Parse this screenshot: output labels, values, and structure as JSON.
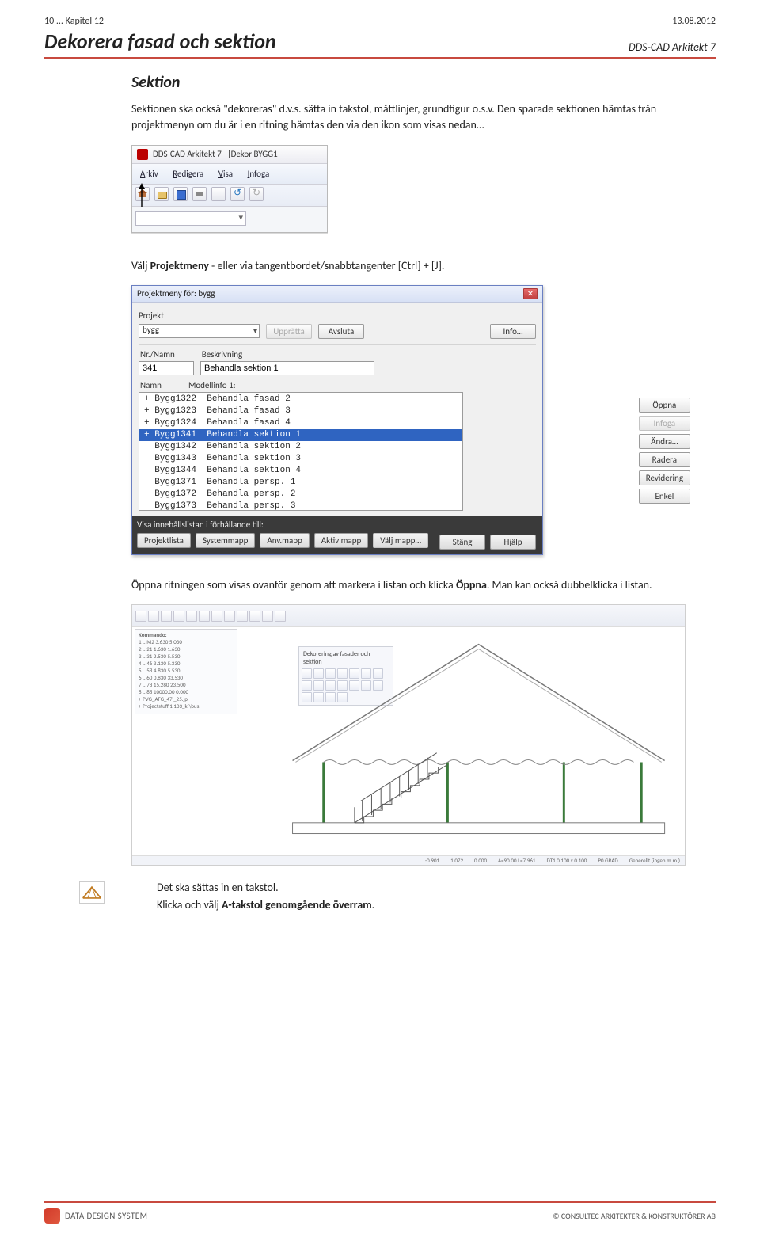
{
  "header": {
    "chapter_ref": "10 ... Kapitel 12",
    "date": "13.08.2012",
    "title_left": "Dekorera fasad och sektion",
    "title_right": "DDS-CAD Arkitekt 7"
  },
  "section": {
    "heading": "Sektion",
    "p1": "Sektionen ska också \"dekoreras\" d.v.s. sätta in takstol, måttlinjer, grundfigur o.s.v. Den sparade sektionen hämtas från projektmenyn om du är i en ritning hämtas den via den ikon som visas nedan…"
  },
  "toolbox": {
    "win_title": "DDS-CAD Arkitekt 7 - [Dekor   BYGG1",
    "menu": {
      "m1": "Arkiv",
      "m2": "Redigera",
      "m3": "Visa",
      "m4": "Infoga"
    }
  },
  "mid_text": "Välj Projektmeny - eller via tangentbordet/snabbtangenter [Ctrl] + [J].",
  "dlg": {
    "title": "Projektmeny för: bygg",
    "projekt_label": "Projekt",
    "projekt_value": "bygg",
    "btn_uppratta": "Upprätta",
    "btn_avsluta": "Avsluta",
    "btn_info": "Info…",
    "col_nr": "Nr./Namn",
    "col_beskr": "Beskrivning",
    "num_field": "341",
    "desc_field": "Behandla sektion 1",
    "col_namn": "Namn",
    "col_model": "Modellinfo 1:",
    "rows": [
      "+ Bygg1322  Behandla fasad 2",
      "+ Bygg1323  Behandla fasad 3",
      "+ Bygg1324  Behandla fasad 4",
      "+ Bygg1341  Behandla sektion 1",
      "  Bygg1342  Behandla sektion 2",
      "  Bygg1343  Behandla sektion 3",
      "  Bygg1344  Behandla sektion 4",
      "  Bygg1371  Behandla persp. 1",
      "  Bygg1372  Behandla persp. 2",
      "  Bygg1373  Behandla persp. 3"
    ],
    "side": {
      "oppna": "Öppna",
      "infoga": "Infoga",
      "andra": "Ändra…",
      "radera": "Radera",
      "revidering": "Revidering",
      "enkel": "Enkel"
    },
    "bottom_label": "Visa innehållslistan i förhållande till:",
    "bottom_btns": {
      "projektlista": "Projektlista",
      "systemmapp": "Systemmapp",
      "anvmapp": "Anv.mapp",
      "aktivmapp": "Aktiv mapp",
      "valjmapp": "Välj mapp…",
      "stang": "Stäng",
      "hjalp": "Hjälp"
    }
  },
  "after_dlg": {
    "part1": "Öppna ritningen som visas ovanför genom att markera i listan och klicka ",
    "bold": "Öppna",
    "part2": ". Man kan också dubbelklicka i listan."
  },
  "cad": {
    "palette_title": "Dekorering av fasader och sektion",
    "panel_title": "Kommando:",
    "panel_lines": [
      " 1 .. M2   3.630   5.030",
      " 2 .. 21   1.630   1.630",
      " 3 .. 31   2.530   5.530",
      " 4 .. 46   3.130   5.330",
      " 5 .. 58   4.830   5.530",
      " 6 .. 60   0.830  33.530",
      " 7 .. 78  15.280  23.500",
      " 8 .. 88  10000.00  0.000",
      " + PVG_AFG_47'_25.jp",
      " + Projectstuff.1  103_k:\\bus."
    ],
    "status": {
      "s1": "-0.901",
      "s2": "1.072",
      "s3": "0.000",
      "s4": "A=90.00 L=7.961",
      "s5": "DT1    0.100 x 0.100",
      "s6": "P0.GRAD",
      "s7": "Generellt (ingen m.m.)"
    }
  },
  "end": {
    "line1": "Det ska sättas in en takstol.",
    "line2_pre": "Klicka och välj ",
    "line2_bold": "A-takstol genomgående överram",
    "line2_post": "."
  },
  "footer": {
    "logo_text": "DATA DESIGN SYSTEM",
    "copyright": "©  CONSULTEC ARKITEKTER & KONSTRUKTÖRER AB"
  }
}
